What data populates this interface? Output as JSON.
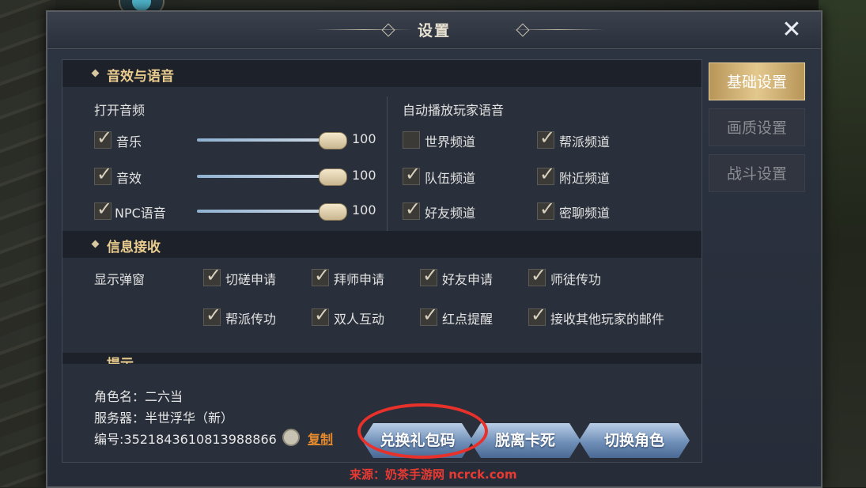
{
  "window": {
    "title": "设置",
    "close_icon": "close-x-icon"
  },
  "tabs": [
    {
      "label": "基础设置",
      "active": true
    },
    {
      "label": "画质设置",
      "active": false
    },
    {
      "label": "战斗设置",
      "active": false
    }
  ],
  "sound": {
    "header": "音效与语音",
    "open_audio_label": "打开音频",
    "items": [
      {
        "label": "音乐",
        "checked": true,
        "value": "100"
      },
      {
        "label": "音效",
        "checked": true,
        "value": "100"
      },
      {
        "label": "NPC语音",
        "checked": true,
        "value": "100"
      }
    ],
    "auto_voice_label": "自动播放玩家语音",
    "channels": [
      {
        "label": "世界频道",
        "checked": false
      },
      {
        "label": "帮派频道",
        "checked": true
      },
      {
        "label": "队伍频道",
        "checked": true
      },
      {
        "label": "附近频道",
        "checked": true
      },
      {
        "label": "好友频道",
        "checked": true
      },
      {
        "label": "密聊频道",
        "checked": true
      }
    ]
  },
  "info": {
    "header": "信息接收",
    "popup_label": "显示弹窗",
    "options": [
      {
        "label": "切磋申请",
        "checked": true
      },
      {
        "label": "拜师申请",
        "checked": true
      },
      {
        "label": "好友申请",
        "checked": true
      },
      {
        "label": "师徒传功",
        "checked": true
      },
      {
        "label": "帮派传功",
        "checked": true
      },
      {
        "label": "双人互动",
        "checked": true
      },
      {
        "label": "红点提醒",
        "checked": true
      },
      {
        "label": "接收其他玩家的邮件",
        "checked": true
      }
    ]
  },
  "partial_section": {
    "header": "提示"
  },
  "account": {
    "role_name": "角色名：二六当",
    "server": "服务器：半世浮华（新）",
    "id": "编号:3521843610813988866",
    "copy_label": "复制"
  },
  "buttons": {
    "redeem": "兑换礼包码",
    "unstuck": "脱离卡死",
    "switch_role": "切换角色"
  },
  "watermark": "来源：奶茶手游网 ncrck.com",
  "colors": {
    "accent_gold": "#e9cc8e",
    "highlight_red": "#e8312b",
    "button_blue": "#6f8fb8"
  }
}
